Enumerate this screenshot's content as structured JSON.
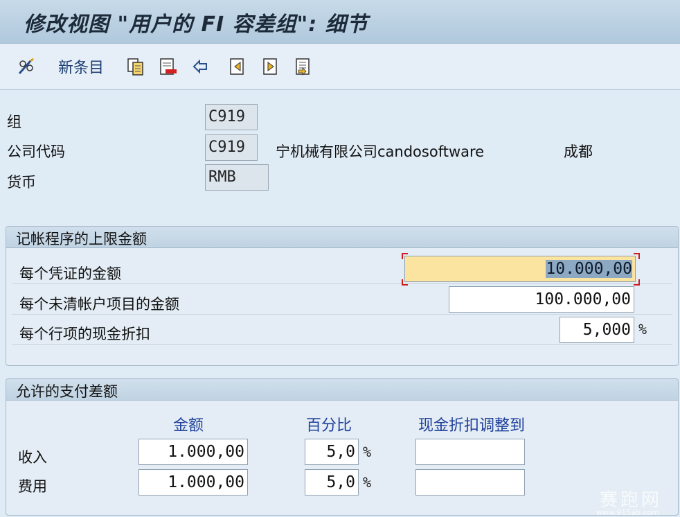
{
  "window": {
    "title": "修改视图 \"用户的 FI 容差组\": 细节"
  },
  "toolbar": {
    "new_entries_label": "新条目",
    "icons": [
      "pencil-glasses-icon",
      "copy-icon",
      "delete-icon",
      "undo-icon",
      "previous-entry-icon",
      "next-entry-icon",
      "select-all-icon"
    ]
  },
  "header": {
    "group_label": "组",
    "group_value": "C919",
    "company_label": "公司代码",
    "company_value": "C919",
    "company_name": "宁机械有限公司candosoftware",
    "company_city": "成都",
    "currency_label": "货币",
    "currency_value": "RMB"
  },
  "posting_limits": {
    "title": "记帐程序的上限金额",
    "per_document_label": "每个凭证的金额",
    "per_document_value": "10.000,00",
    "per_open_item_label": "每个未清帐户项目的金额",
    "per_open_item_value": "100.000,00",
    "cash_discount_label": "每个行项的现金折扣",
    "cash_discount_value": "5,000",
    "percent_sign": "%"
  },
  "payment_differences": {
    "title": "允许的支付差额",
    "col_amount": "金额",
    "col_percent": "百分比",
    "col_discount_adjust": "现金折扣调整到",
    "percent_sign": "%",
    "revenue": {
      "label": "收入",
      "amount": "1.000,00",
      "percent": "5,0",
      "adjust": ""
    },
    "expense": {
      "label": "费用",
      "amount": "1.000,00",
      "percent": "5,0",
      "adjust": ""
    }
  },
  "watermark": {
    "text": "赛跑网",
    "url": "www.915ab.com"
  },
  "colors": {
    "focus_bg": "#fbe3a0",
    "focus_corner": "#d21c1c",
    "column_head": "#1e3f99"
  }
}
